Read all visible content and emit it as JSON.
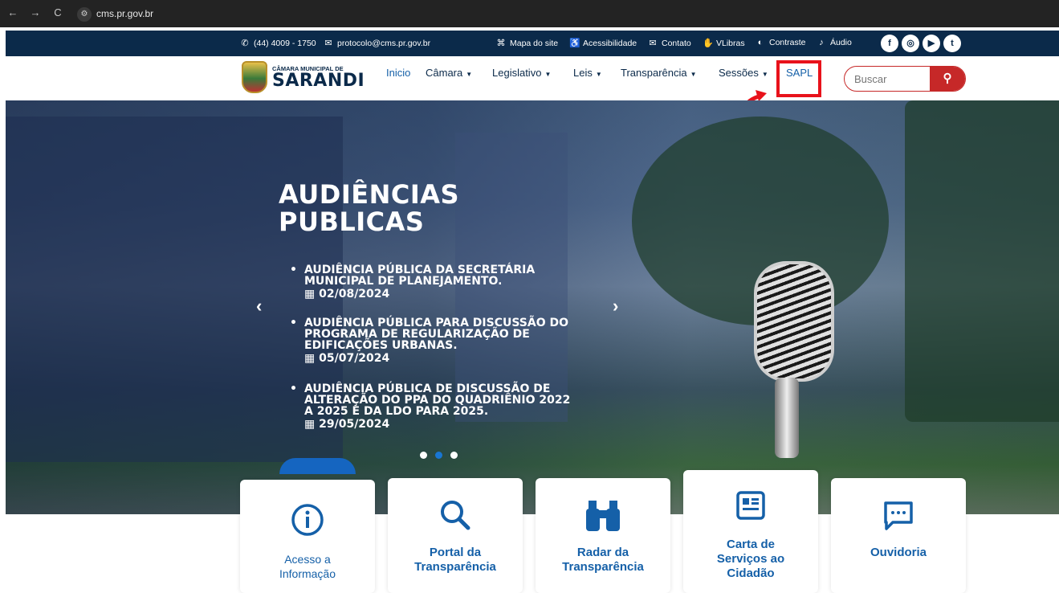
{
  "browser": {
    "url": "cms.pr.gov.br",
    "back": "←",
    "forward": "→",
    "reload": "C",
    "site_icon": "⚙"
  },
  "topbar": {
    "phone": "(44) 4009 - 1750",
    "email": "protocolo@cms.pr.gov.br",
    "links": [
      "Mapa do site",
      "Acessibilidade",
      "Contato",
      "VLibras",
      "Contraste",
      "Áudio"
    ],
    "social": [
      "f",
      "◎",
      "▶",
      "t"
    ]
  },
  "header": {
    "logo_small": "CÂMARA MUNICIPAL DE",
    "logo_big": "SARANDI",
    "menu": [
      {
        "label": "Inicio",
        "dropdown": false,
        "active": true
      },
      {
        "label": "Câmara",
        "dropdown": true
      },
      {
        "label": "Legislativo",
        "dropdown": true
      },
      {
        "label": "Leis",
        "dropdown": true
      },
      {
        "label": "Transparência",
        "dropdown": true
      },
      {
        "label": "Sessões",
        "dropdown": true
      },
      {
        "label": "SAPL",
        "dropdown": false,
        "highlighted": true
      }
    ],
    "search_placeholder": "Buscar",
    "caret": "▼"
  },
  "hero": {
    "title_line1": "AUDIÊNCIAS",
    "title_line2": "PUBLICAS",
    "items": [
      {
        "title_lines": [
          "AUDIÊNCIA PÚBLICA DA SECRETÁRIA",
          "MUNICIPAL DE PLANEJAMENTO."
        ],
        "date": "02/08/2024"
      },
      {
        "title_lines": [
          "AUDIÊNCIA PÚBLICA PARA DISCUSSÃO DO",
          "PROGRAMA DE REGULARIZAÇÃO DE",
          "EDIFICAÇÕES URBANAS."
        ],
        "date": "05/07/2024"
      },
      {
        "title_lines": [
          "AUDIÊNCIA PÚBLICA DE DISCUSSÃO DE",
          "ALTERAÇÃO DO PPA DO QUADRIÊNIO 2022",
          "A 2025 E DA LDO PARA 2025."
        ],
        "date": "29/05/2024"
      }
    ],
    "prev_arrow": "‹",
    "next_arrow": "›",
    "active_dot_index": 1,
    "dot_count": 3
  },
  "cards": [
    {
      "label_lines": [
        "Acesso a",
        "Informação"
      ],
      "icon": "info-icon",
      "bold": false
    },
    {
      "label_lines": [
        "Portal da",
        "Transparência"
      ],
      "icon": "search-icon",
      "bold": true
    },
    {
      "label_lines": [
        "Radar da",
        "Transparência"
      ],
      "icon": "binoculars-icon",
      "bold": true
    },
    {
      "label_lines": [
        "Carta de",
        "Serviços ao",
        "Cidadão"
      ],
      "icon": "newspaper-icon",
      "bold": true
    },
    {
      "label_lines": [
        "Ouvidoria"
      ],
      "icon": "chat-icon",
      "bold": true
    }
  ],
  "colors": {
    "navy": "#0b2a4a",
    "link_blue": "#1560a8",
    "brand_red": "#c62828",
    "highlight_red": "#e8121b"
  }
}
